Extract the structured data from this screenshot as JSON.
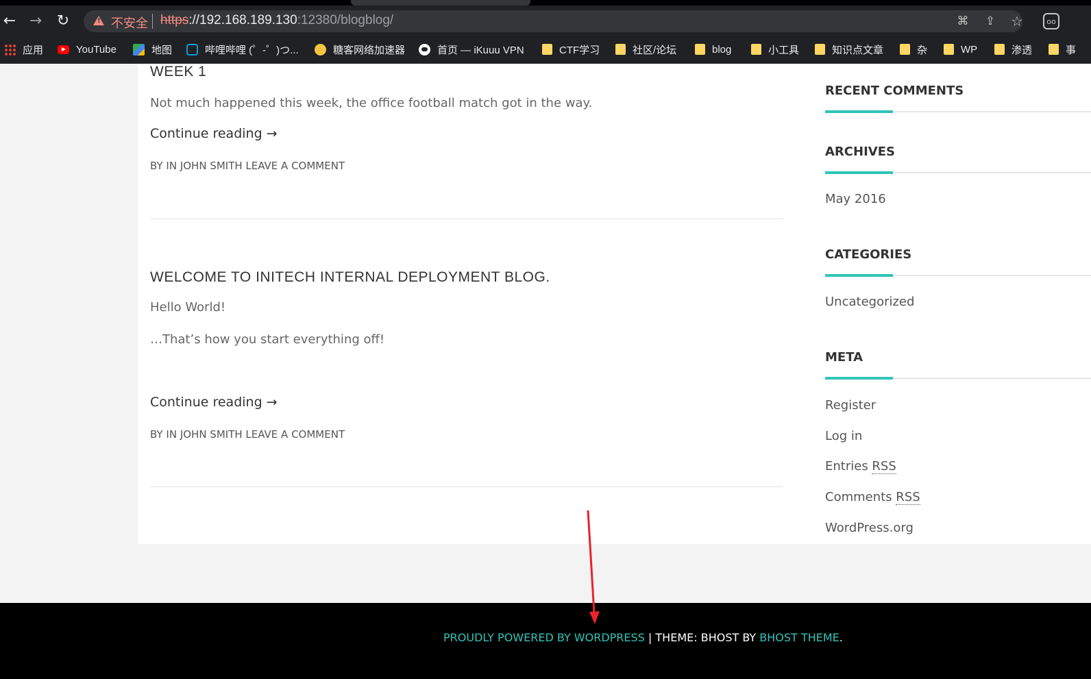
{
  "browser": {
    "security_label": "不安全",
    "url_scheme": "https",
    "url_host": "://192.168.189.130",
    "url_rest": ":12380/blogblog/",
    "back_glyph": "←",
    "forward_glyph": "→",
    "reload_glyph": "↻",
    "translate_glyph": "⌘",
    "share_glyph": "⇪",
    "star_glyph": "☆",
    "ext_glyph": "oo",
    "bookmarks": [
      {
        "label": "应用",
        "icon": "apps-grid-icon"
      },
      {
        "label": "YouTube",
        "icon": "youtube-icon"
      },
      {
        "label": "地图",
        "icon": "maps-icon"
      },
      {
        "label": "哔哩哔哩 (゜-゜)つ...",
        "icon": "bilibili-icon"
      },
      {
        "label": "糖客网络加速器",
        "icon": "duck-icon"
      },
      {
        "label": "首页 — iKuuu VPN",
        "icon": "ikuuu-icon"
      },
      {
        "label": "CTF学习",
        "icon": "folder-icon"
      },
      {
        "label": "社区/论坛",
        "icon": "folder-icon"
      },
      {
        "label": "blog",
        "icon": "folder-icon"
      },
      {
        "label": "小工具",
        "icon": "folder-icon"
      },
      {
        "label": "知识点文章",
        "icon": "folder-icon"
      },
      {
        "label": "杂",
        "icon": "folder-icon"
      },
      {
        "label": "WP",
        "icon": "folder-icon"
      },
      {
        "label": "渗透",
        "icon": "folder-icon"
      },
      {
        "label": "事",
        "icon": "folder-icon"
      }
    ]
  },
  "posts": [
    {
      "title": "WEEK 1",
      "excerpt": "Not much happened this week, the office football match got in the way.",
      "continue": "Continue reading →",
      "byline": "BY IN JOHN SMITH LEAVE A COMMENT"
    },
    {
      "title": "WELCOME TO INITECH INTERNAL DEPLOYMENT BLOG.",
      "paragraphs": [
        "Hello World!",
        "…That’s how you start everything off!"
      ],
      "continue": "Continue reading →",
      "byline": "BY IN JOHN SMITH LEAVE A COMMENT"
    }
  ],
  "sidebar": {
    "recent_comments_title": "RECENT COMMENTS",
    "archives_title": "ARCHIVES",
    "archives": [
      "May 2016"
    ],
    "categories_title": "CATEGORIES",
    "categories": [
      "Uncategorized"
    ],
    "meta_title": "META",
    "meta": {
      "register": "Register",
      "login": "Log in",
      "entries_prefix": "Entries ",
      "comments_prefix": "Comments ",
      "rss": "RSS",
      "wordpress": "WordPress.org"
    }
  },
  "footer": {
    "powered": "PROUDLY POWERED BY WORDPRESS",
    "divider": " | ",
    "theme_prefix": "THEME: BHOST BY ",
    "theme_link": "BHOST THEME",
    "period": "."
  },
  "colors": {
    "accent": "#31c4b8",
    "annotation_arrow": "#e8232a",
    "footer_bg": "#000000",
    "chrome_bg": "#202124"
  }
}
